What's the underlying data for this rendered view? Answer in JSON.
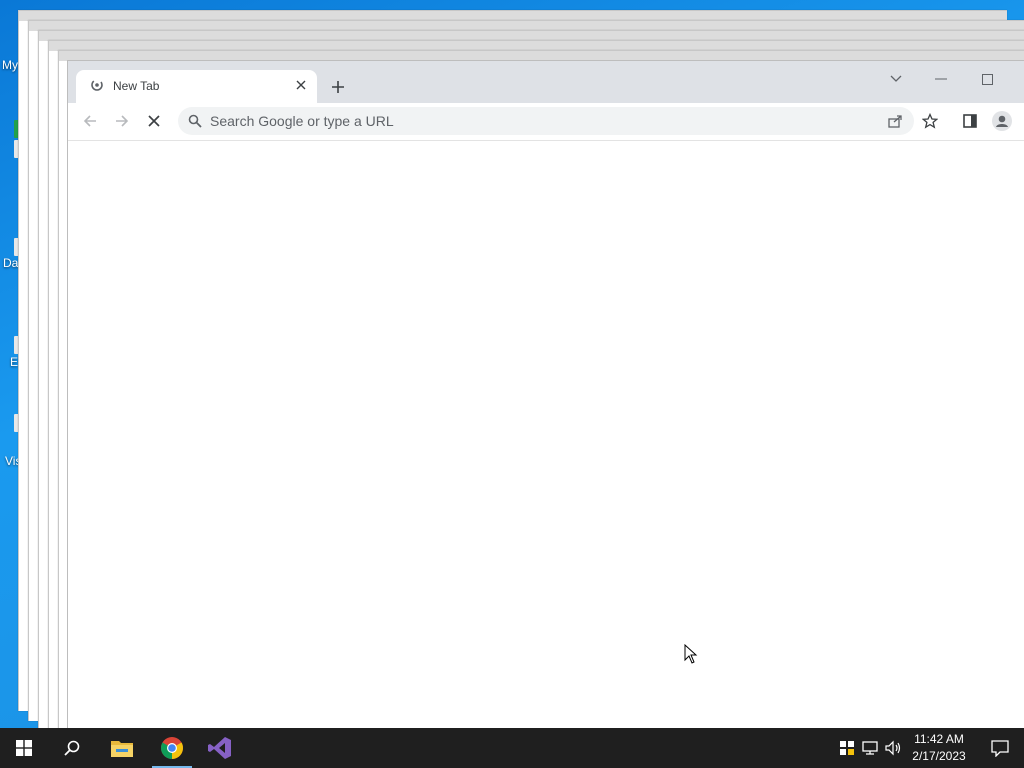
{
  "desktop": {
    "icons": [
      {
        "label": "My",
        "icon": "computer-icon"
      },
      {
        "label": "Da",
        "icon": "database-icon"
      },
      {
        "label": "E",
        "icon": "app-icon"
      },
      {
        "label": "Vis",
        "icon": "visual-studio-icon"
      }
    ]
  },
  "browser": {
    "tab": {
      "title": "New Tab",
      "favicon": "loading-icon"
    },
    "window_controls": [
      "tab-search",
      "minimize",
      "maximize"
    ],
    "toolbar": {
      "back_icon": "back-arrow-icon",
      "forward_icon": "forward-arrow-icon",
      "stop_icon": "stop-loading-icon"
    },
    "omnibox": {
      "placeholder": "Search Google or type a URL",
      "value": ""
    },
    "toolbar_right": [
      "share-icon",
      "bookmark-star-icon",
      "side-panel-icon",
      "profile-icon"
    ]
  },
  "taskbar": {
    "apps": [
      "windows-start-icon",
      "search-icon",
      "file-explorer-icon",
      "chrome-icon",
      "visual-studio-icon"
    ],
    "active_app": "chrome-icon",
    "tray": [
      "security-icon",
      "network-icon",
      "volume-icon"
    ],
    "clock": {
      "time": "11:42 AM",
      "date": "2/17/2023"
    },
    "notifications_icon": "action-center-icon"
  },
  "colors": {
    "desktop": "#1a9aef",
    "tabstrip": "#dee1e6",
    "taskbar": "#1f1f1f",
    "omnibox": "#f1f3f4"
  }
}
